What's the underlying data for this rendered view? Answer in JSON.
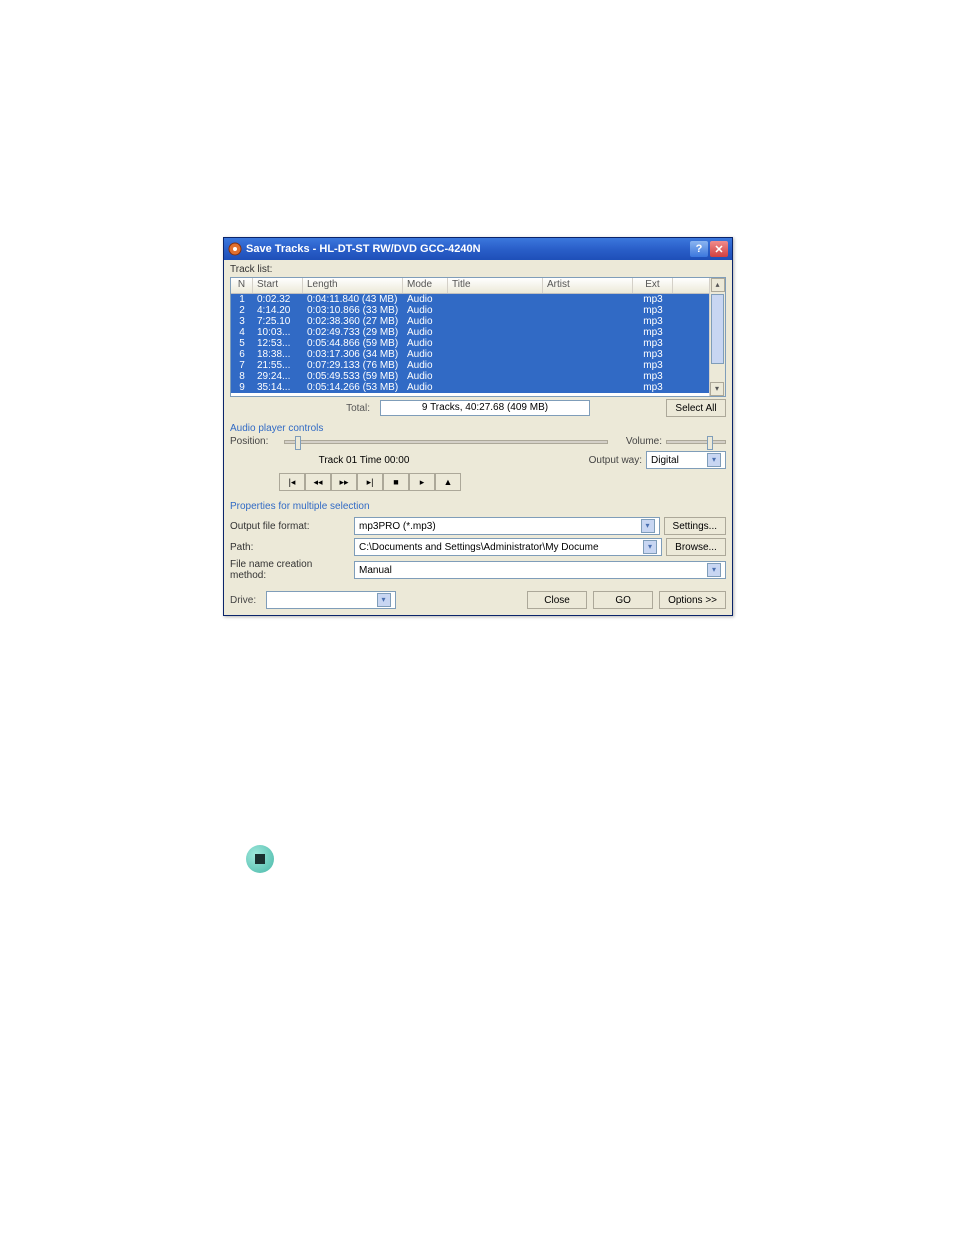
{
  "titlebar": {
    "title": "Save Tracks - HL-DT-ST RW/DVD GCC-4240N"
  },
  "sections": {
    "tracklist_label": "Track list:",
    "audio_controls_label": "Audio player controls",
    "properties_label": "Properties for multiple selection"
  },
  "columns": {
    "n": "N",
    "start": "Start",
    "length": "Length",
    "mode": "Mode",
    "title": "Title",
    "artist": "Artist",
    "ext": "Ext"
  },
  "tracks": [
    {
      "n": "1",
      "start": "0:02.32",
      "length": "0:04:11.840 (43 MB)",
      "mode": "Audio",
      "title": "",
      "artist": "",
      "ext": "mp3"
    },
    {
      "n": "2",
      "start": "4:14.20",
      "length": "0:03:10.866 (33 MB)",
      "mode": "Audio",
      "title": "",
      "artist": "",
      "ext": "mp3"
    },
    {
      "n": "3",
      "start": "7:25.10",
      "length": "0:02:38.360 (27 MB)",
      "mode": "Audio",
      "title": "",
      "artist": "",
      "ext": "mp3"
    },
    {
      "n": "4",
      "start": "10:03...",
      "length": "0:02:49.733 (29 MB)",
      "mode": "Audio",
      "title": "",
      "artist": "",
      "ext": "mp3"
    },
    {
      "n": "5",
      "start": "12:53...",
      "length": "0:05:44.866 (59 MB)",
      "mode": "Audio",
      "title": "",
      "artist": "",
      "ext": "mp3"
    },
    {
      "n": "6",
      "start": "18:38...",
      "length": "0:03:17.306 (34 MB)",
      "mode": "Audio",
      "title": "",
      "artist": "",
      "ext": "mp3"
    },
    {
      "n": "7",
      "start": "21:55...",
      "length": "0:07:29.133 (76 MB)",
      "mode": "Audio",
      "title": "",
      "artist": "",
      "ext": "mp3"
    },
    {
      "n": "8",
      "start": "29:24...",
      "length": "0:05:49.533 (59 MB)",
      "mode": "Audio",
      "title": "",
      "artist": "",
      "ext": "mp3"
    },
    {
      "n": "9",
      "start": "35:14...",
      "length": "0:05:14.266 (53 MB)",
      "mode": "Audio",
      "title": "",
      "artist": "",
      "ext": "mp3"
    }
  ],
  "totals": {
    "label": "Total:",
    "text": "9 Tracks,   40:27.68 (409 MB)"
  },
  "buttons": {
    "selectall": "Select All",
    "settings": "Settings...",
    "browse": "Browse...",
    "close": "Close",
    "go": "GO",
    "options": "Options >>"
  },
  "player": {
    "position_label": "Position:",
    "track_info": "Track 01 Time 00:00",
    "volume_label": "Volume:",
    "outputway_label": "Output way:",
    "outputway_value": "Digital"
  },
  "form": {
    "format_label": "Output file format:",
    "format_value": "mp3PRO (*.mp3)",
    "path_label": "Path:",
    "path_value": "C:\\Documents and Settings\\Administrator\\My Docume",
    "method_label": "File name creation method:",
    "method_value": "Manual"
  },
  "bottom": {
    "drive_label": "Drive:",
    "drive_value": ""
  }
}
